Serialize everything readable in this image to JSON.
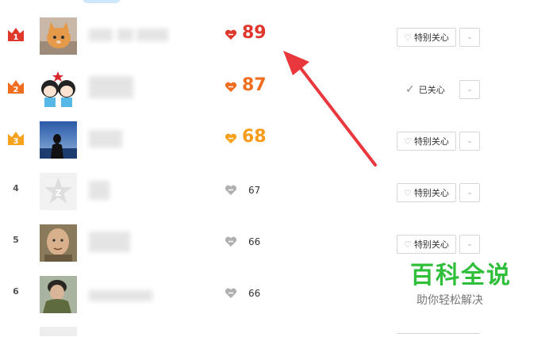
{
  "rows": [
    {
      "rank": "1",
      "score": "89",
      "score_color": "#e0372c",
      "heart_color": "#e0372c",
      "avatar": "cat",
      "status": "care"
    },
    {
      "rank": "2",
      "score": "87",
      "score_color": "#f06c1e",
      "heart_color": "#f06c1e",
      "avatar": "cartoon-couple",
      "status": "cared"
    },
    {
      "rank": "3",
      "score": "68",
      "score_color": "#f79c1a",
      "heart_color": "#f79c1a",
      "avatar": "sea-person",
      "status": "care"
    },
    {
      "rank": "4",
      "score": "67",
      "score_color": "#333333",
      "heart_color": "#b0b0b0",
      "avatar": "default-q",
      "status": "care"
    },
    {
      "rank": "5",
      "score": "66",
      "score_color": "#333333",
      "heart_color": "#b0b0b0",
      "avatar": "face",
      "status": "care"
    },
    {
      "rank": "6",
      "score": "66",
      "score_color": "#333333",
      "heart_color": "#b0b0b0",
      "avatar": "soldier",
      "status": "care"
    }
  ],
  "labels": {
    "special_care": "特别关心",
    "already_cared": "已关心",
    "dropdown": "⌄"
  },
  "watermark": {
    "title": "百科全说",
    "subtitle": "助你轻松解决"
  },
  "colors": {
    "rank1_crown": "#e0372c",
    "rank2_crown": "#f06c1e",
    "rank3_crown": "#f7a21e",
    "arrow": "#e8383d",
    "watermark_green": "#2fbf3a"
  }
}
